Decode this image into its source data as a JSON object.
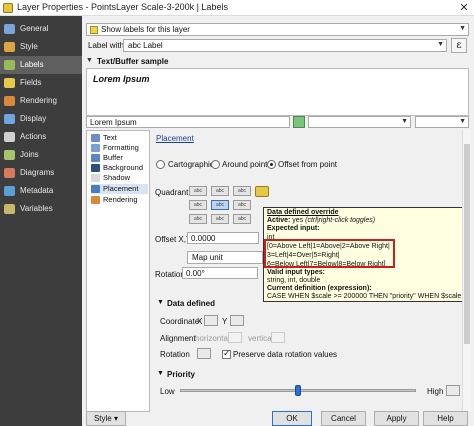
{
  "window": {
    "title": "Layer Properties - PointsLayer Scale-3-200k | Labels",
    "close_glyph": "✕"
  },
  "sidebar": {
    "items": [
      {
        "label": "General",
        "icon": "wrench-icon",
        "color": "#7da4d6"
      },
      {
        "label": "Style",
        "icon": "style-brush-icon",
        "color": "#d9a640"
      },
      {
        "label": "Labels",
        "icon": "abc-labels-icon",
        "color": "#9ab95a"
      },
      {
        "label": "Fields",
        "icon": "fields-table-icon",
        "color": "#e6c84a"
      },
      {
        "label": "Rendering",
        "icon": "paintbrush-icon",
        "color": "#d88a3a"
      },
      {
        "label": "Display",
        "icon": "speech-bubble-icon",
        "color": "#6ea6df"
      },
      {
        "label": "Actions",
        "icon": "gear-icon",
        "color": "#d0d0d0"
      },
      {
        "label": "Joins",
        "icon": "joins-icon",
        "color": "#a6c46a"
      },
      {
        "label": "Diagrams",
        "icon": "diagram-icon",
        "color": "#d87a5a"
      },
      {
        "label": "Metadata",
        "icon": "metadata-icon",
        "color": "#5aa0d8"
      },
      {
        "label": "Variables",
        "icon": "variables-icon",
        "color": "#c9b86a"
      }
    ],
    "active_index": 2
  },
  "labels_mode": {
    "value": "Show labels for this layer"
  },
  "label_with": {
    "caption": "Label with",
    "value": "abc Label",
    "epsilon": "ε"
  },
  "sample": {
    "heading": "Text/Buffer sample",
    "text": "Lorem Ipsum",
    "input_value": "Lorem Ipsum"
  },
  "tree": {
    "items": [
      {
        "label": "Text",
        "icon": "text-abc-icon",
        "color": "#6b8fc4"
      },
      {
        "label": "Formatting",
        "icon": "formatting-icon",
        "color": "#7aa0d2"
      },
      {
        "label": "Buffer",
        "icon": "buffer-icon",
        "color": "#5b86c5"
      },
      {
        "label": "Background",
        "icon": "background-icon",
        "color": "#2f4f7f"
      },
      {
        "label": "Shadow",
        "icon": "shadow-icon",
        "color": "#dadada"
      },
      {
        "label": "Placement",
        "icon": "placement-icon",
        "color": "#4a7dbf"
      },
      {
        "label": "Rendering",
        "icon": "rendering-icon",
        "color": "#d88a3a"
      }
    ],
    "active_index": 5
  },
  "placement": {
    "heading": "Placement",
    "modes": [
      {
        "label": "Cartographic",
        "checked": false
      },
      {
        "label": "Around point",
        "checked": false
      },
      {
        "label": "Offset from point",
        "checked": true
      }
    ],
    "quadrant_label": "Quadrant",
    "quadrant_cell_text": "abc",
    "quadrant_selected": 4,
    "offset_label": "Offset X,Y",
    "offset_x": "0.0000",
    "unit_value": "Map unit",
    "rotation_label": "Rotation",
    "rotation_value": "0.00°"
  },
  "tooltip": {
    "title": "Data defined override",
    "active_prefix": "Active:",
    "active_value": "yes",
    "active_hint": "(ctrl|right-click toggles)",
    "expected": "Expected input:",
    "type_int": "int",
    "line1": "[0=Above Left|1=Above|2=Above Right|",
    "line2": "3=Left|4=Over|5=Right|",
    "line3": "6=Below Left|7=Below|8=Below Right]",
    "valid_types": "Valid input types:",
    "types_value": "string, int, double",
    "current_def": "Current definition (expression):",
    "expression": "CASE WHEN $scale >= 200000 THEN \"priority\" WHEN $scale"
  },
  "data_defined": {
    "heading": "Data defined",
    "coordinate_label": "Coordinate",
    "x_label": "X",
    "y_label": "Y",
    "alignment_label": "Alignment",
    "horizontal_label": "horizontal",
    "vertical_label": "vertical",
    "rotation_label": "Rotation",
    "preserve_label": "Preserve data rotation values",
    "preserve_checked": true
  },
  "priority": {
    "heading": "Priority",
    "low": "Low",
    "high": "High",
    "level": 0.5
  },
  "buttons": {
    "style": "Style",
    "ok": "OK",
    "cancel": "Cancel",
    "apply": "Apply",
    "help": "Help"
  },
  "colors": {
    "sidebar_bg": "#3d3d3d",
    "sidebar_active": "#5f5f5f",
    "tooltip_bg": "#ffffe1",
    "highlight_red": "#d01c1c",
    "accent_blue": "#2b6fd6"
  }
}
